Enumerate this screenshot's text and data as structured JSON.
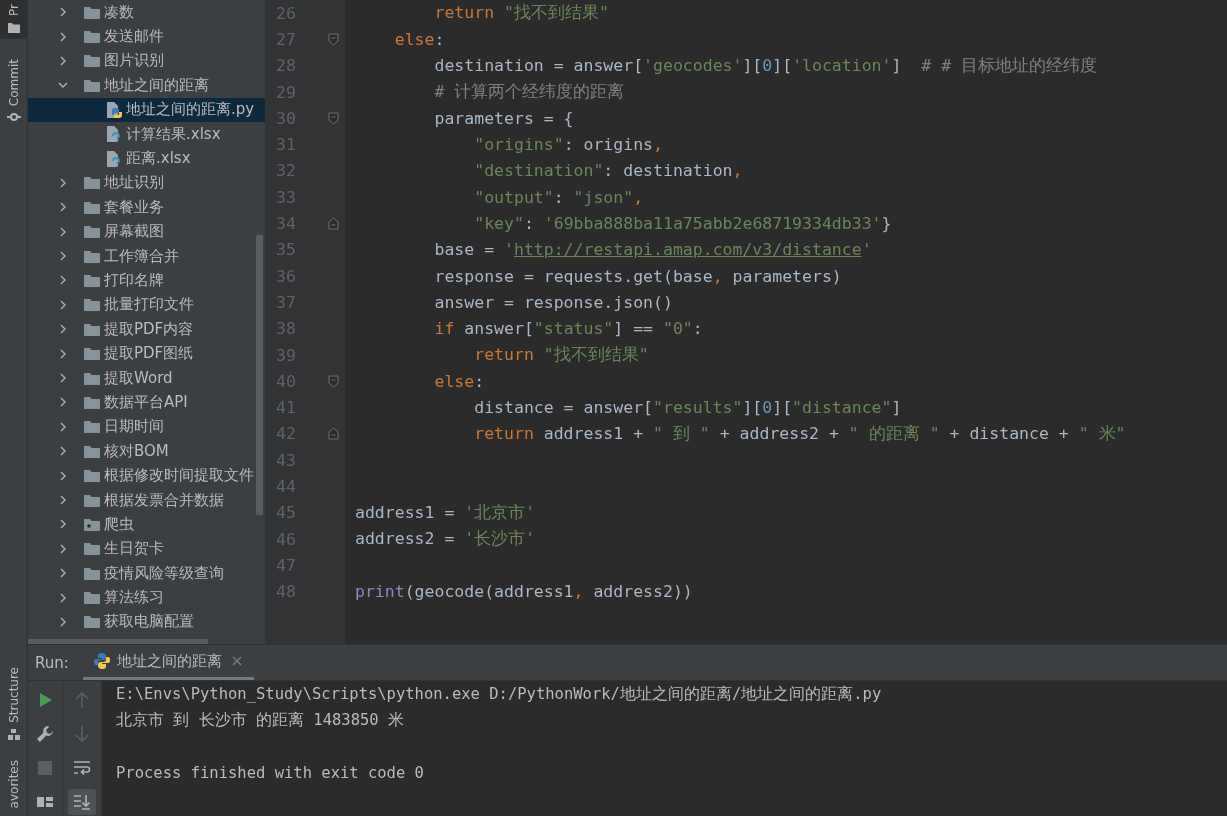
{
  "tool_stripe": {
    "top": [
      {
        "label": "Pr",
        "kind": "project",
        "selected": true
      },
      {
        "label": "Commit",
        "kind": "commit",
        "selected": false
      }
    ],
    "bottom": [
      {
        "label": "Structure",
        "kind": "structure",
        "selected": false
      },
      {
        "label": "avorites",
        "kind": "favorites",
        "selected": false
      }
    ]
  },
  "project_tree": {
    "items": [
      {
        "label": "凑数",
        "kind": "folder",
        "expanded": false,
        "selected": false
      },
      {
        "label": "发送邮件",
        "kind": "folder",
        "expanded": false,
        "selected": false
      },
      {
        "label": "图片识别",
        "kind": "folder",
        "expanded": false,
        "selected": false
      },
      {
        "label": "地址之间的距离",
        "kind": "folder",
        "expanded": true,
        "selected": false,
        "children": [
          {
            "label": "地址之间的距离.py",
            "kind": "python-file",
            "selected": true
          },
          {
            "label": "计算结果.xlsx",
            "kind": "unknown-file",
            "selected": false
          },
          {
            "label": "距离.xlsx",
            "kind": "unknown-file",
            "selected": false
          }
        ]
      },
      {
        "label": "地址识别",
        "kind": "folder",
        "expanded": false,
        "selected": false
      },
      {
        "label": "套餐业务",
        "kind": "folder",
        "expanded": false,
        "selected": false
      },
      {
        "label": "屏幕截图",
        "kind": "folder",
        "expanded": false,
        "selected": false
      },
      {
        "label": "工作簿合并",
        "kind": "folder",
        "expanded": false,
        "selected": false
      },
      {
        "label": "打印名牌",
        "kind": "folder",
        "expanded": false,
        "selected": false
      },
      {
        "label": "批量打印文件",
        "kind": "folder",
        "expanded": false,
        "selected": false
      },
      {
        "label": "提取PDF内容",
        "kind": "folder",
        "expanded": false,
        "selected": false
      },
      {
        "label": "提取PDF图纸",
        "kind": "folder",
        "expanded": false,
        "selected": false
      },
      {
        "label": "提取Word",
        "kind": "folder",
        "expanded": false,
        "selected": false
      },
      {
        "label": "数据平台API",
        "kind": "folder",
        "expanded": false,
        "selected": false
      },
      {
        "label": "日期时间",
        "kind": "folder",
        "expanded": false,
        "selected": false
      },
      {
        "label": "核对BOM",
        "kind": "folder",
        "expanded": false,
        "selected": false
      },
      {
        "label": "根据修改时间提取文件",
        "kind": "folder",
        "expanded": false,
        "selected": false
      },
      {
        "label": "根据发票合并数据",
        "kind": "folder",
        "expanded": false,
        "selected": false
      },
      {
        "label": "爬虫",
        "kind": "package",
        "expanded": false,
        "selected": false
      },
      {
        "label": "生日贺卡",
        "kind": "folder",
        "expanded": false,
        "selected": false
      },
      {
        "label": "疫情风险等级查询",
        "kind": "folder",
        "expanded": false,
        "selected": false
      },
      {
        "label": "算法练习",
        "kind": "folder",
        "expanded": false,
        "selected": false
      },
      {
        "label": "获取电脑配置",
        "kind": "folder",
        "expanded": false,
        "selected": false
      }
    ]
  },
  "editor": {
    "lines": [
      {
        "number": "26",
        "tokens": [
          {
            "kind": "keyword",
            "text": "        return "
          },
          {
            "kind": "string",
            "text": "\"找不到结果\""
          }
        ]
      },
      {
        "number": "27",
        "fold_start": true,
        "tokens": [
          {
            "kind": "keyword",
            "text": "    else"
          },
          {
            "kind": "plain",
            "text": ":"
          }
        ]
      },
      {
        "number": "28",
        "tokens": [
          {
            "kind": "plain",
            "text": "        destination = answer["
          },
          {
            "kind": "string",
            "text": "'geocodes'"
          },
          {
            "kind": "plain",
            "text": "]["
          },
          {
            "kind": "number",
            "text": "0"
          },
          {
            "kind": "plain",
            "text": "]["
          },
          {
            "kind": "string",
            "text": "'location'"
          },
          {
            "kind": "plain",
            "text": "]  "
          },
          {
            "kind": "comment",
            "text": "# # 目标地址的经纬度"
          }
        ]
      },
      {
        "number": "29",
        "tokens": [
          {
            "kind": "comment",
            "text": "        # 计算两个经纬度的距离"
          }
        ]
      },
      {
        "number": "30",
        "fold_start": true,
        "tokens": [
          {
            "kind": "plain",
            "text": "        parameters = {"
          }
        ]
      },
      {
        "number": "31",
        "tokens": [
          {
            "kind": "string",
            "text": "            \"origins\""
          },
          {
            "kind": "plain",
            "text": ": origins"
          },
          {
            "kind": "keyword",
            "text": ","
          }
        ]
      },
      {
        "number": "32",
        "tokens": [
          {
            "kind": "string",
            "text": "            \"destination\""
          },
          {
            "kind": "plain",
            "text": ": destination"
          },
          {
            "kind": "keyword",
            "text": ","
          }
        ]
      },
      {
        "number": "33",
        "tokens": [
          {
            "kind": "string",
            "text": "            \"output\""
          },
          {
            "kind": "plain",
            "text": ": "
          },
          {
            "kind": "string",
            "text": "\"json\""
          },
          {
            "kind": "keyword",
            "text": ","
          }
        ]
      },
      {
        "number": "34",
        "fold_end": true,
        "tokens": [
          {
            "kind": "string",
            "text": "            \"key\""
          },
          {
            "kind": "plain",
            "text": ": "
          },
          {
            "kind": "string",
            "text": "'69bba888ba11a75abb2e68719334db33'"
          },
          {
            "kind": "plain",
            "text": "}"
          }
        ]
      },
      {
        "number": "35",
        "tokens": [
          {
            "kind": "plain",
            "text": "        base = "
          },
          {
            "kind": "string",
            "text": "'"
          },
          {
            "kind": "url",
            "text": "http://restapi.amap.com/v3/distance"
          },
          {
            "kind": "string",
            "text": "'"
          }
        ]
      },
      {
        "number": "36",
        "tokens": [
          {
            "kind": "plain",
            "text": "        response = requests.get(base"
          },
          {
            "kind": "keyword",
            "text": ","
          },
          {
            "kind": "plain",
            "text": " parameters)"
          }
        ]
      },
      {
        "number": "37",
        "tokens": [
          {
            "kind": "plain",
            "text": "        answer = response.json()"
          }
        ]
      },
      {
        "number": "38",
        "tokens": [
          {
            "kind": "keyword",
            "text": "        if"
          },
          {
            "kind": "plain",
            "text": " answer["
          },
          {
            "kind": "string",
            "text": "\"status\""
          },
          {
            "kind": "plain",
            "text": "] == "
          },
          {
            "kind": "string",
            "text": "\"0\""
          },
          {
            "kind": "plain",
            "text": ":"
          }
        ]
      },
      {
        "number": "39",
        "tokens": [
          {
            "kind": "keyword",
            "text": "            return "
          },
          {
            "kind": "string",
            "text": "\"找不到结果\""
          }
        ]
      },
      {
        "number": "40",
        "fold_start": true,
        "tokens": [
          {
            "kind": "keyword",
            "text": "        else"
          },
          {
            "kind": "plain",
            "text": ":"
          }
        ]
      },
      {
        "number": "41",
        "tokens": [
          {
            "kind": "plain",
            "text": "            distance = answer["
          },
          {
            "kind": "string",
            "text": "\"results\""
          },
          {
            "kind": "plain",
            "text": "]["
          },
          {
            "kind": "number",
            "text": "0"
          },
          {
            "kind": "plain",
            "text": "]["
          },
          {
            "kind": "string",
            "text": "\"distance\""
          },
          {
            "kind": "plain",
            "text": "]"
          }
        ]
      },
      {
        "number": "42",
        "fold_end": true,
        "tokens": [
          {
            "kind": "keyword",
            "text": "            return"
          },
          {
            "kind": "plain",
            "text": " address1 + "
          },
          {
            "kind": "string",
            "text": "\" 到 \""
          },
          {
            "kind": "plain",
            "text": " + address2 + "
          },
          {
            "kind": "string",
            "text": "\" 的距离 \""
          },
          {
            "kind": "plain",
            "text": " + distance + "
          },
          {
            "kind": "string",
            "text": "\" 米\""
          }
        ]
      },
      {
        "number": "43"
      },
      {
        "number": "44"
      },
      {
        "number": "45",
        "tokens": [
          {
            "kind": "plain",
            "text": "address1 = "
          },
          {
            "kind": "string",
            "text": "'北京市'"
          }
        ]
      },
      {
        "number": "46",
        "tokens": [
          {
            "kind": "plain",
            "text": "address2 = "
          },
          {
            "kind": "string",
            "text": "'长沙市'"
          }
        ]
      },
      {
        "number": "47"
      },
      {
        "number": "48",
        "tokens": [
          {
            "kind": "builtin",
            "text": "print"
          },
          {
            "kind": "plain",
            "text": "(geocode(address1"
          },
          {
            "kind": "keyword",
            "text": ","
          },
          {
            "kind": "plain",
            "text": " address2))"
          }
        ]
      }
    ]
  },
  "run_panel": {
    "label": "Run:",
    "tab": {
      "title": "地址之间的距离",
      "selected": true
    },
    "toolbar": [
      {
        "kind": "rerun",
        "disabled": false
      },
      {
        "kind": "settings",
        "disabled": false
      },
      {
        "kind": "stop",
        "disabled": true
      },
      {
        "kind": "layout",
        "disabled": false
      }
    ],
    "toolbar_2": [
      {
        "kind": "up",
        "disabled": true,
        "selected": false
      },
      {
        "kind": "down",
        "disabled": true,
        "selected": false
      },
      {
        "kind": "wrap",
        "disabled": false,
        "selected": false
      },
      {
        "kind": "scroll-end",
        "disabled": false,
        "selected": true
      }
    ],
    "output": {
      "command": "E:\\Envs\\Python_Study\\Scripts\\python.exe D:/PythonWork/地址之间的距离/地址之间的距离.py",
      "stdout": [
        "北京市 到 长沙市 的距离 1483850 米"
      ],
      "exit_message": "Process finished with exit code 0"
    }
  }
}
